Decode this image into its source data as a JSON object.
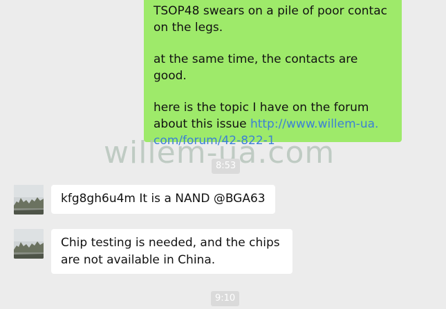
{
  "messages": {
    "outgoing": {
      "line1": "TSOP48 swears on a pile of poor contac",
      "line2": "on the legs.",
      "para2": "at the same time, the contacts are good.",
      "para3_line1": "here is the topic I have on the forum",
      "para3_line2_text": "about this issue ",
      "link_part1": "http://www.willem-ua.",
      "link_part2": "com/forum/42-822-1"
    },
    "incoming": [
      {
        "text": "kfg8gh6u4m It is a NAND @BGA63"
      },
      {
        "line1": "Chip testing is needed, and the chips",
        "line2": "are not available in China."
      }
    ]
  },
  "timestamps": [
    "8:53",
    "9:10"
  ],
  "watermark": "willem-ua.com",
  "colors": {
    "outgoing_bubble": "#9eea6a",
    "incoming_bubble": "#ffffff",
    "background": "#ececec",
    "link": "#3b7fd6"
  }
}
